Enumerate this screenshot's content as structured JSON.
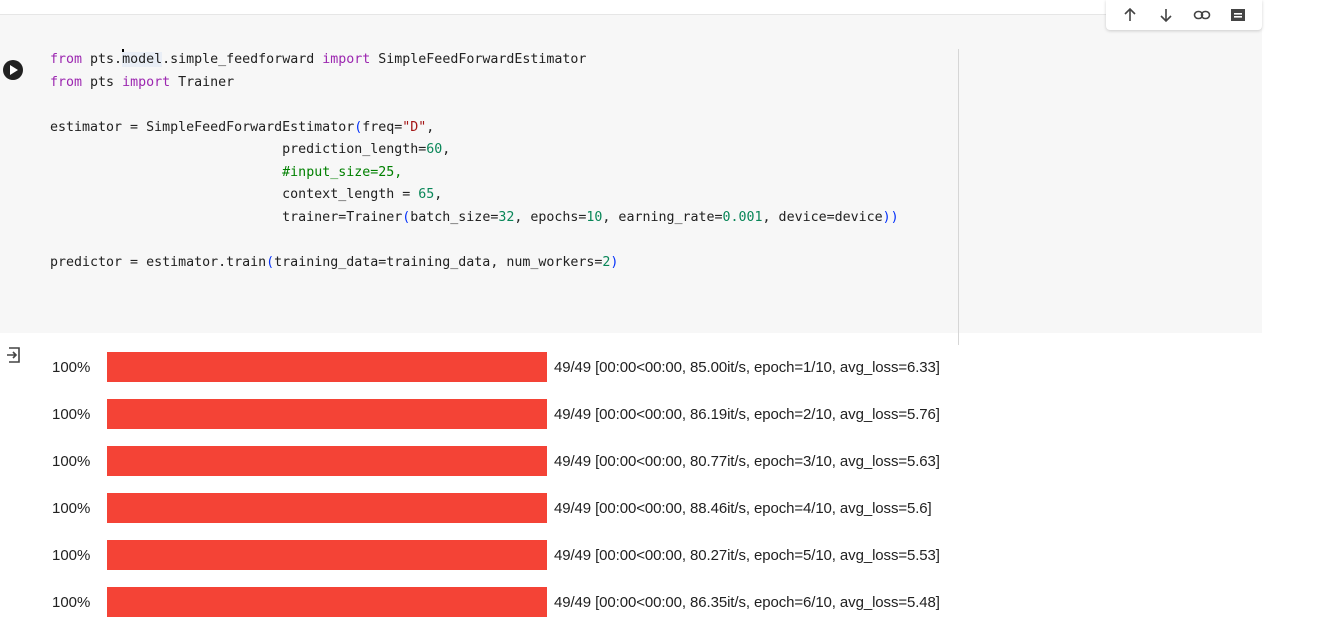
{
  "toolbar": {
    "icons": [
      "arrow-up-icon",
      "arrow-down-icon",
      "link-icon",
      "comment-icon"
    ]
  },
  "code_lines": [
    [
      {
        "t": "from",
        "c": "kw"
      },
      {
        "t": " pts."
      },
      {
        "t": "m",
        "c": "cur"
      },
      {
        "t": "odel",
        "c": "hl"
      },
      {
        "t": ".simple_feedforward "
      },
      {
        "t": "import",
        "c": "kw"
      },
      {
        "t": " SimpleFeedForwardEstimator"
      }
    ],
    [
      {
        "t": "from",
        "c": "kw"
      },
      {
        "t": " pts "
      },
      {
        "t": "import",
        "c": "kw"
      },
      {
        "t": " Trainer"
      }
    ],
    [],
    [
      {
        "t": "estimator = SimpleFeedForwardEstimator"
      },
      {
        "t": "(",
        "c": "br"
      },
      {
        "t": "freq="
      },
      {
        "t": "\"D\"",
        "c": "str"
      },
      {
        "t": ","
      }
    ],
    [
      {
        "t": "                             prediction_length="
      },
      {
        "t": "60",
        "c": "num"
      },
      {
        "t": ","
      }
    ],
    [
      {
        "t": "                             "
      },
      {
        "t": "#input_size=25,",
        "c": "cm"
      }
    ],
    [
      {
        "t": "                             context_length = "
      },
      {
        "t": "65",
        "c": "num"
      },
      {
        "t": ","
      }
    ],
    [
      {
        "t": "                             trainer=Trainer"
      },
      {
        "t": "(",
        "c": "br"
      },
      {
        "t": "batch_size="
      },
      {
        "t": "32",
        "c": "num"
      },
      {
        "t": ", epochs="
      },
      {
        "t": "10",
        "c": "num"
      },
      {
        "t": ", earning_rate="
      },
      {
        "t": "0.001",
        "c": "num"
      },
      {
        "t": ", device=device"
      },
      {
        "t": "))",
        "c": "br"
      }
    ],
    [],
    [
      {
        "t": "predictor = estimator.train"
      },
      {
        "t": "(",
        "c": "br"
      },
      {
        "t": "training_data=training_data, num_workers="
      },
      {
        "t": "2",
        "c": "num"
      },
      {
        "t": ")",
        "c": "br"
      }
    ]
  ],
  "progress": [
    {
      "percent_label": "100%",
      "fraction": 1.0,
      "info": "49/49 [00:00<00:00, 85.00it/s, epoch=1/10, avg_loss=6.33]"
    },
    {
      "percent_label": "100%",
      "fraction": 1.0,
      "info": "49/49 [00:00<00:00, 86.19it/s, epoch=2/10, avg_loss=5.76]"
    },
    {
      "percent_label": "100%",
      "fraction": 1.0,
      "info": "49/49 [00:00<00:00, 80.77it/s, epoch=3/10, avg_loss=5.63]"
    },
    {
      "percent_label": "100%",
      "fraction": 1.0,
      "info": "49/49 [00:00<00:00, 88.46it/s, epoch=4/10, avg_loss=5.6]"
    },
    {
      "percent_label": "100%",
      "fraction": 1.0,
      "info": "49/49 [00:00<00:00, 80.27it/s, epoch=5/10, avg_loss=5.53]"
    },
    {
      "percent_label": "100%",
      "fraction": 1.0,
      "info": "49/49 [00:00<00:00, 86.35it/s, epoch=6/10, avg_loss=5.48]"
    }
  ],
  "colors": {
    "progress_fill": "#f44336",
    "keyword": "#9c27b0",
    "number": "#098658",
    "string": "#a31515",
    "comment": "#008000"
  }
}
